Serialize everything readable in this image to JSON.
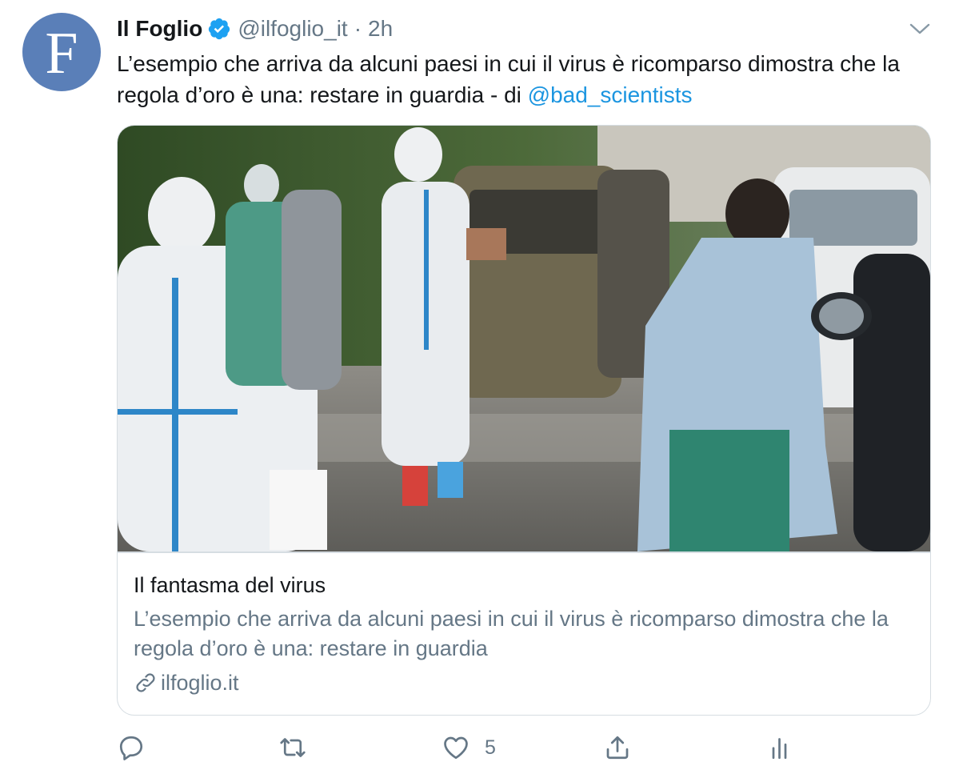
{
  "tweet": {
    "avatar_letter": "F",
    "author_name": "Il Foglio",
    "author_handle": "@ilfoglio_it",
    "separator": "·",
    "time": "2h",
    "text_plain": "L’esempio che arriva da alcuni paesi in cui il virus è ricomparso dimostra che la regola d’oro è una: restare in guardia - di ",
    "text_mention": "@bad_scientists"
  },
  "card": {
    "title": "Il fantasma del virus",
    "description": "L’esempio che arriva da alcuni paesi in cui il virus è ricomparso dimostra che la regola d’oro è una: restare in guardia",
    "domain": "ilfoglio.it"
  },
  "actions": {
    "reply_count": "",
    "retweet_count": "",
    "like_count": "5"
  },
  "icons": {
    "verified": "verified-badge-icon",
    "caret": "chevron-down-icon",
    "link": "link-icon",
    "reply": "reply-icon",
    "retweet": "retweet-icon",
    "like": "heart-icon",
    "share": "share-icon",
    "analytics": "analytics-icon"
  },
  "colors": {
    "accent": "#1b95e0",
    "secondary_text": "#657786",
    "avatar_bg": "#5a7fb8",
    "border": "#d6dde2"
  }
}
